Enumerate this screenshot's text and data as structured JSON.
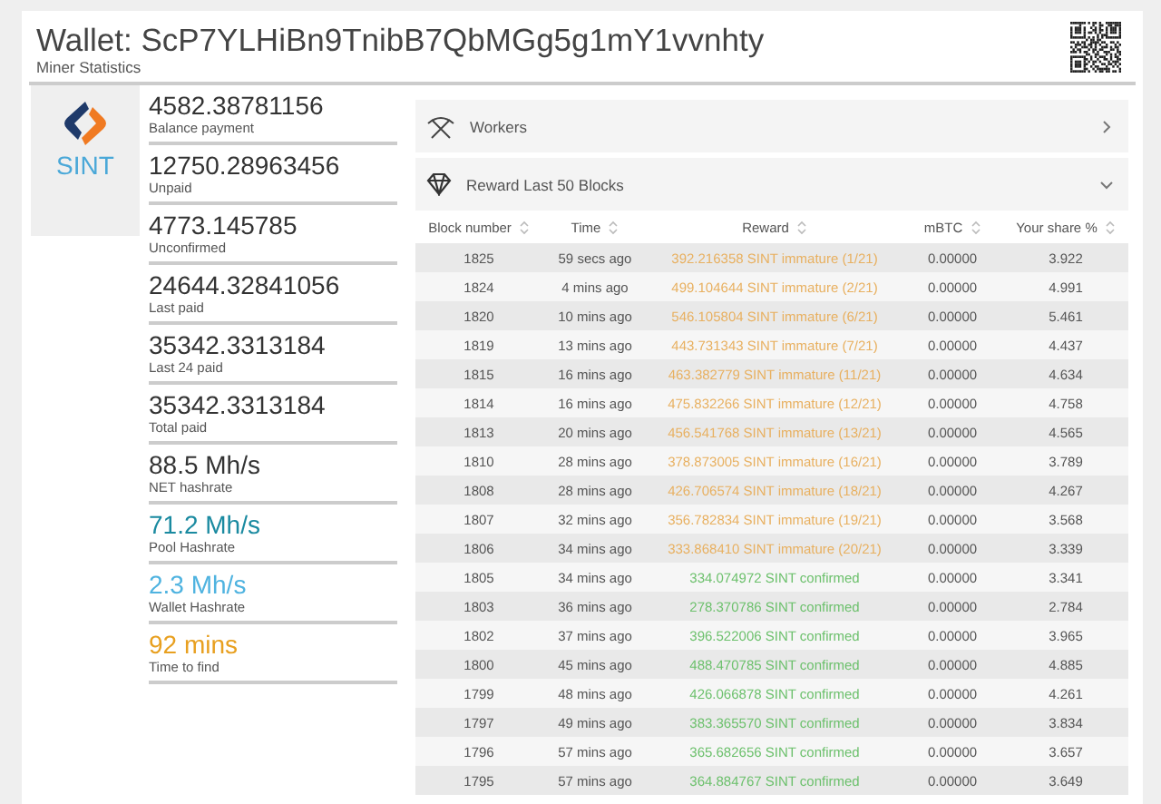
{
  "header": {
    "title": "Wallet: ScP7YLHiBn9TnibB7QbMGg5g1mY1vvnhty",
    "subtitle": "Miner Statistics"
  },
  "coin": {
    "name": "SINT"
  },
  "stats": [
    {
      "value": "4582.38781156",
      "label": "Balance payment",
      "color": "#333333"
    },
    {
      "value": "12750.28963456",
      "label": "Unpaid",
      "color": "#333333"
    },
    {
      "value": "4773.145785",
      "label": "Unconfirmed",
      "color": "#333333"
    },
    {
      "value": "24644.32841056",
      "label": "Last paid",
      "color": "#333333"
    },
    {
      "value": "35342.3313184",
      "label": "Last 24 paid",
      "color": "#333333"
    },
    {
      "value": "35342.3313184",
      "label": "Total paid",
      "color": "#333333"
    },
    {
      "value": "88.5 Mh/s",
      "label": "NET hashrate",
      "color": "#333333"
    },
    {
      "value": "71.2 Mh/s",
      "label": "Pool Hashrate",
      "color": "#1a8aa0"
    },
    {
      "value": "2.3 Mh/s",
      "label": "Wallet Hashrate",
      "color": "#4fb3e0"
    },
    {
      "value": "92 mins",
      "label": "Time to find",
      "color": "#e8a020"
    }
  ],
  "panels": [
    {
      "kind": "workers",
      "title": "Workers",
      "expanded": false
    },
    {
      "kind": "reward",
      "title": "Reward Last 50 Blocks",
      "expanded": true
    }
  ],
  "table": {
    "columns": [
      "Block number",
      "Time",
      "Reward",
      "mBTC",
      "Your share %"
    ],
    "rows": [
      {
        "block": "1825",
        "time": "59 secs ago",
        "reward": "392.216358 SINT immature (1/21)",
        "kind": "immature",
        "mbtc": "0.00000",
        "share": "3.922"
      },
      {
        "block": "1824",
        "time": "4 mins ago",
        "reward": "499.104644 SINT immature (2/21)",
        "kind": "immature",
        "mbtc": "0.00000",
        "share": "4.991"
      },
      {
        "block": "1820",
        "time": "10 mins ago",
        "reward": "546.105804 SINT immature (6/21)",
        "kind": "immature",
        "mbtc": "0.00000",
        "share": "5.461"
      },
      {
        "block": "1819",
        "time": "13 mins ago",
        "reward": "443.731343 SINT immature (7/21)",
        "kind": "immature",
        "mbtc": "0.00000",
        "share": "4.437"
      },
      {
        "block": "1815",
        "time": "16 mins ago",
        "reward": "463.382779 SINT immature (11/21)",
        "kind": "immature",
        "mbtc": "0.00000",
        "share": "4.634"
      },
      {
        "block": "1814",
        "time": "16 mins ago",
        "reward": "475.832266 SINT immature (12/21)",
        "kind": "immature",
        "mbtc": "0.00000",
        "share": "4.758"
      },
      {
        "block": "1813",
        "time": "20 mins ago",
        "reward": "456.541768 SINT immature (13/21)",
        "kind": "immature",
        "mbtc": "0.00000",
        "share": "4.565"
      },
      {
        "block": "1810",
        "time": "28 mins ago",
        "reward": "378.873005 SINT immature (16/21)",
        "kind": "immature",
        "mbtc": "0.00000",
        "share": "3.789"
      },
      {
        "block": "1808",
        "time": "28 mins ago",
        "reward": "426.706574 SINT immature (18/21)",
        "kind": "immature",
        "mbtc": "0.00000",
        "share": "4.267"
      },
      {
        "block": "1807",
        "time": "32 mins ago",
        "reward": "356.782834 SINT immature (19/21)",
        "kind": "immature",
        "mbtc": "0.00000",
        "share": "3.568"
      },
      {
        "block": "1806",
        "time": "34 mins ago",
        "reward": "333.868410 SINT immature (20/21)",
        "kind": "immature",
        "mbtc": "0.00000",
        "share": "3.339"
      },
      {
        "block": "1805",
        "time": "34 mins ago",
        "reward": "334.074972 SINT confirmed",
        "kind": "confirmed",
        "mbtc": "0.00000",
        "share": "3.341"
      },
      {
        "block": "1803",
        "time": "36 mins ago",
        "reward": "278.370786 SINT confirmed",
        "kind": "confirmed",
        "mbtc": "0.00000",
        "share": "2.784"
      },
      {
        "block": "1802",
        "time": "37 mins ago",
        "reward": "396.522006 SINT confirmed",
        "kind": "confirmed",
        "mbtc": "0.00000",
        "share": "3.965"
      },
      {
        "block": "1800",
        "time": "45 mins ago",
        "reward": "488.470785 SINT confirmed",
        "kind": "confirmed",
        "mbtc": "0.00000",
        "share": "4.885"
      },
      {
        "block": "1799",
        "time": "48 mins ago",
        "reward": "426.066878 SINT confirmed",
        "kind": "confirmed",
        "mbtc": "0.00000",
        "share": "4.261"
      },
      {
        "block": "1797",
        "time": "49 mins ago",
        "reward": "383.365570 SINT confirmed",
        "kind": "confirmed",
        "mbtc": "0.00000",
        "share": "3.834"
      },
      {
        "block": "1796",
        "time": "57 mins ago",
        "reward": "365.682656 SINT confirmed",
        "kind": "confirmed",
        "mbtc": "0.00000",
        "share": "3.657"
      },
      {
        "block": "1795",
        "time": "57 mins ago",
        "reward": "364.884767 SINT confirmed",
        "kind": "confirmed",
        "mbtc": "0.00000",
        "share": "3.649"
      }
    ]
  }
}
